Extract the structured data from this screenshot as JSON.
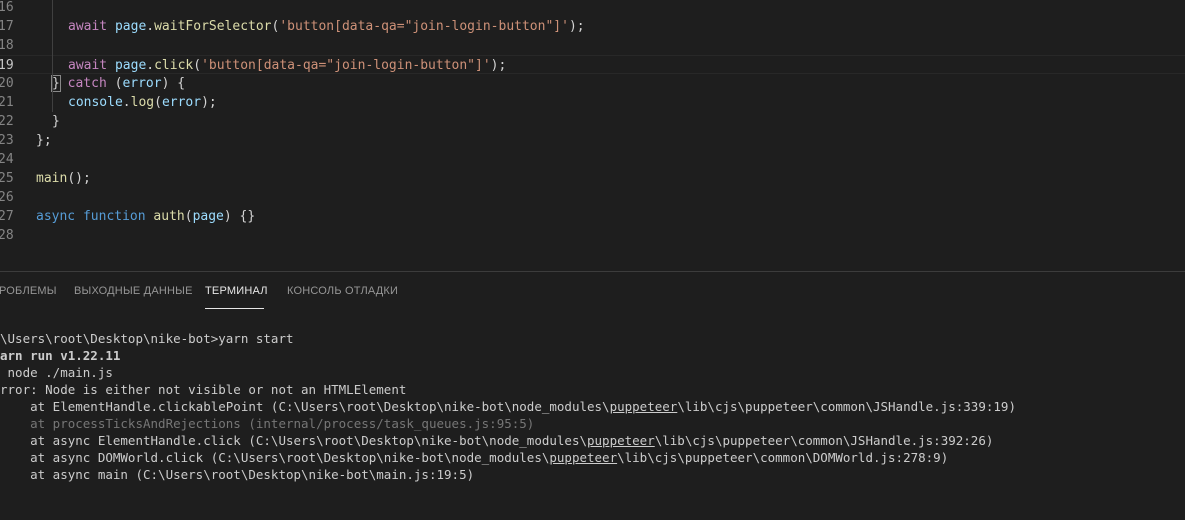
{
  "editor": {
    "lines": [
      {
        "num": "16",
        "tokens": []
      },
      {
        "num": "17",
        "tokens": [
          {
            "t": "await",
            "c": "kw2"
          },
          {
            "t": " ",
            "c": "punc"
          },
          {
            "t": "page",
            "c": "var"
          },
          {
            "t": ".",
            "c": "punc"
          },
          {
            "t": "waitForSelector",
            "c": "fn"
          },
          {
            "t": "(",
            "c": "punc"
          },
          {
            "t": "'button[data-qa=\"join-login-button\"]'",
            "c": "str"
          },
          {
            "t": ");",
            "c": "punc"
          }
        ]
      },
      {
        "num": "18",
        "tokens": []
      },
      {
        "num": "19",
        "tokens": [
          {
            "t": "await",
            "c": "kw2"
          },
          {
            "t": " ",
            "c": "punc"
          },
          {
            "t": "page",
            "c": "var"
          },
          {
            "t": ".",
            "c": "punc"
          },
          {
            "t": "click",
            "c": "fn"
          },
          {
            "t": "(",
            "c": "punc"
          },
          {
            "t": "'button[data-qa=\"join-login-button\"]'",
            "c": "str"
          },
          {
            "t": ");",
            "c": "punc"
          }
        ]
      },
      {
        "num": "20",
        "tokens": [
          {
            "t": "}",
            "c": "punc",
            "m": true
          },
          {
            "t": " ",
            "c": "punc"
          },
          {
            "t": "catch",
            "c": "kw2"
          },
          {
            "t": " (",
            "c": "punc"
          },
          {
            "t": "error",
            "c": "var"
          },
          {
            "t": ") {",
            "c": "punc"
          }
        ]
      },
      {
        "num": "21",
        "tokens": [
          {
            "t": "console",
            "c": "var"
          },
          {
            "t": ".",
            "c": "punc"
          },
          {
            "t": "log",
            "c": "fn"
          },
          {
            "t": "(",
            "c": "punc"
          },
          {
            "t": "error",
            "c": "var"
          },
          {
            "t": ");",
            "c": "punc"
          }
        ]
      },
      {
        "num": "22",
        "tokens": [
          {
            "t": "}",
            "c": "punc"
          }
        ]
      },
      {
        "num": "23",
        "tokens": [
          {
            "t": "};",
            "c": "punc"
          }
        ]
      },
      {
        "num": "24",
        "tokens": []
      },
      {
        "num": "25",
        "tokens": [
          {
            "t": "main",
            "c": "fn"
          },
          {
            "t": "();",
            "c": "punc"
          }
        ]
      },
      {
        "num": "26",
        "tokens": []
      },
      {
        "num": "27",
        "tokens": [
          {
            "t": "async",
            "c": "kw"
          },
          {
            "t": " ",
            "c": "punc"
          },
          {
            "t": "function",
            "c": "kw"
          },
          {
            "t": " ",
            "c": "punc"
          },
          {
            "t": "auth",
            "c": "fn"
          },
          {
            "t": "(",
            "c": "punc"
          },
          {
            "t": "page",
            "c": "var"
          },
          {
            "t": ") {}",
            "c": "punc"
          }
        ]
      },
      {
        "num": "28",
        "tokens": []
      }
    ],
    "current_line": "19"
  },
  "panel": {
    "tabs": [
      {
        "label": "ПРОБЛЕМЫ",
        "shown": "РОБЛЕМЫ",
        "active": false
      },
      {
        "label": "ВЫХОДНЫЕ ДАННЫЕ",
        "shown": "ВЫХОДНЫЕ ДАННЫЕ",
        "active": false
      },
      {
        "label": "ТЕРМИНАЛ",
        "shown": "ТЕРМИНАЛ",
        "active": true
      },
      {
        "label": "КОНСОЛЬ ОТЛАДКИ",
        "shown": "КОНСОЛЬ ОТЛАДКИ",
        "active": false
      }
    ]
  },
  "terminal": {
    "lines": [
      {
        "text": "\\Users\\root\\Desktop\\nike-bot>yarn start",
        "style": "normal"
      },
      {
        "text": "arn run v1.22.11",
        "style": "bold"
      },
      {
        "text": " node ./main.js",
        "style": "normal"
      },
      {
        "text": "rror: Node is either not visible or not an HTMLElement",
        "style": "normal"
      },
      {
        "text": "    at ElementHandle.clickablePoint (C:\\Users\\root\\Desktop\\nike-bot\\node_modules\\puppeteer\\lib\\cjs\\puppeteer\\common\\JSHandle.js:339:19)",
        "style": "normal"
      },
      {
        "text": "    at processTicksAndRejections (internal/process/task_queues.js:95:5)",
        "style": "dim"
      },
      {
        "text": "    at async ElementHandle.click (C:\\Users\\root\\Desktop\\nike-bot\\node_modules\\puppeteer\\lib\\cjs\\puppeteer\\common\\JSHandle.js:392:26)",
        "style": "normal"
      },
      {
        "text": "    at async DOMWorld.click (C:\\Users\\root\\Desktop\\nike-bot\\node_modules\\puppeteer\\lib\\cjs\\puppeteer\\common\\DOMWorld.js:278:9)",
        "style": "normal"
      },
      {
        "text": "    at async main (C:\\Users\\root\\Desktop\\nike-bot\\main.js:19:5)",
        "style": "normal"
      }
    ],
    "underline_word": "puppeteer"
  }
}
